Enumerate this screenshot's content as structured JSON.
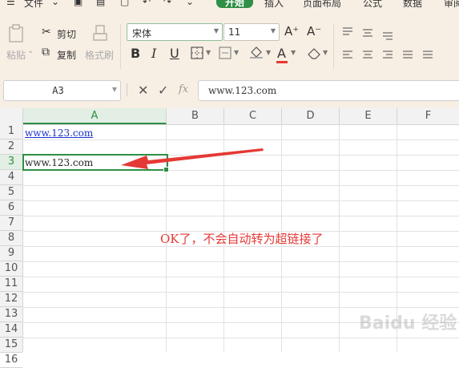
{
  "menubar": {
    "items": [
      "文件",
      "开始",
      "插入",
      "页面布局",
      "公式",
      "数据",
      "审阅"
    ]
  },
  "ribbon": {
    "paste_label": "粘贴",
    "cut_label": "剪切",
    "copy_label": "复制",
    "format_painter_label": "格式刷",
    "font_name": "宋体",
    "font_size": "11",
    "bold": "B",
    "italic": "I",
    "underline": "U",
    "grow_font": "A⁺",
    "shrink_font": "A⁻",
    "font_color_glyph": "A",
    "accent_color": "#2f8f46",
    "font_color_bar": "#e53935"
  },
  "formula_bar": {
    "name_box": "A3",
    "fx": "fx",
    "content": "www.123.com"
  },
  "grid": {
    "columns": [
      "A",
      "B",
      "C",
      "D",
      "E",
      "F"
    ],
    "rows": [
      "1",
      "2",
      "3",
      "4",
      "5",
      "6",
      "7",
      "8",
      "9",
      "10",
      "11",
      "12",
      "13",
      "14",
      "15",
      "16"
    ],
    "cell_A1": "www.123.com",
    "cell_A3": "www.123.com",
    "active_cell": "A3"
  },
  "annotation": {
    "text": "OK了，不会自动转为超链接了",
    "color": "#e53935"
  },
  "watermark": "Baidu 经验"
}
